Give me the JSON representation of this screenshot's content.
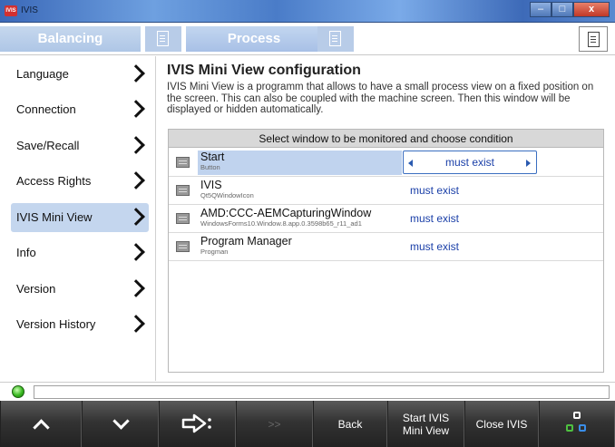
{
  "window": {
    "title": "IVIS",
    "app_icon_text": "IVIS",
    "minimize_glyph": "–",
    "maximize_glyph": "□",
    "close_glyph": "x"
  },
  "tabs": [
    {
      "label": "Balancing"
    },
    {
      "label": "Process"
    }
  ],
  "sidebar": {
    "items": [
      {
        "label": "Language"
      },
      {
        "label": "Connection"
      },
      {
        "label": "Save/Recall"
      },
      {
        "label": "Access Rights"
      },
      {
        "label": "IVIS Mini View",
        "active": true
      },
      {
        "label": "Info"
      },
      {
        "label": "Version"
      },
      {
        "label": "Version History"
      }
    ]
  },
  "main": {
    "heading": "IVIS Mini View configuration",
    "description": "IVIS Mini View is a programm that allows to have a small process view on a fixed position on the screen. This can also be coupled with the machine screen. Then this window will be displayed or hidden automatically.",
    "panel_header": "Select window to be monitored and choose condition",
    "rows": [
      {
        "name": "Start",
        "sub": "Button",
        "condition": "must exist",
        "selected": true
      },
      {
        "name": "IVIS",
        "sub": "Qt5QWindowIcon",
        "condition": "must exist"
      },
      {
        "name": "AMD:CCC-AEMCapturingWindow",
        "sub": "WindowsForms10.Window.8.app.0.3598b65_r11_ad1",
        "condition": "must exist"
      },
      {
        "name": "Program Manager",
        "sub": "Progman",
        "condition": "must exist"
      }
    ]
  },
  "status": {
    "led_color": "#38b820",
    "field_text": ""
  },
  "toolbar": {
    "up_icon": "chevron-up-icon",
    "down_icon": "chevron-down-icon",
    "next_icon": "arrow-right-icon",
    "skip_label": ">>",
    "back_label": "Back",
    "start_label": "Start IVIS Mini View",
    "close_label": "Close IVIS",
    "grid_icon": "app-grid-icon"
  },
  "colors": {
    "accent": "#1a3fa8",
    "selection": "#c4d6ee"
  }
}
